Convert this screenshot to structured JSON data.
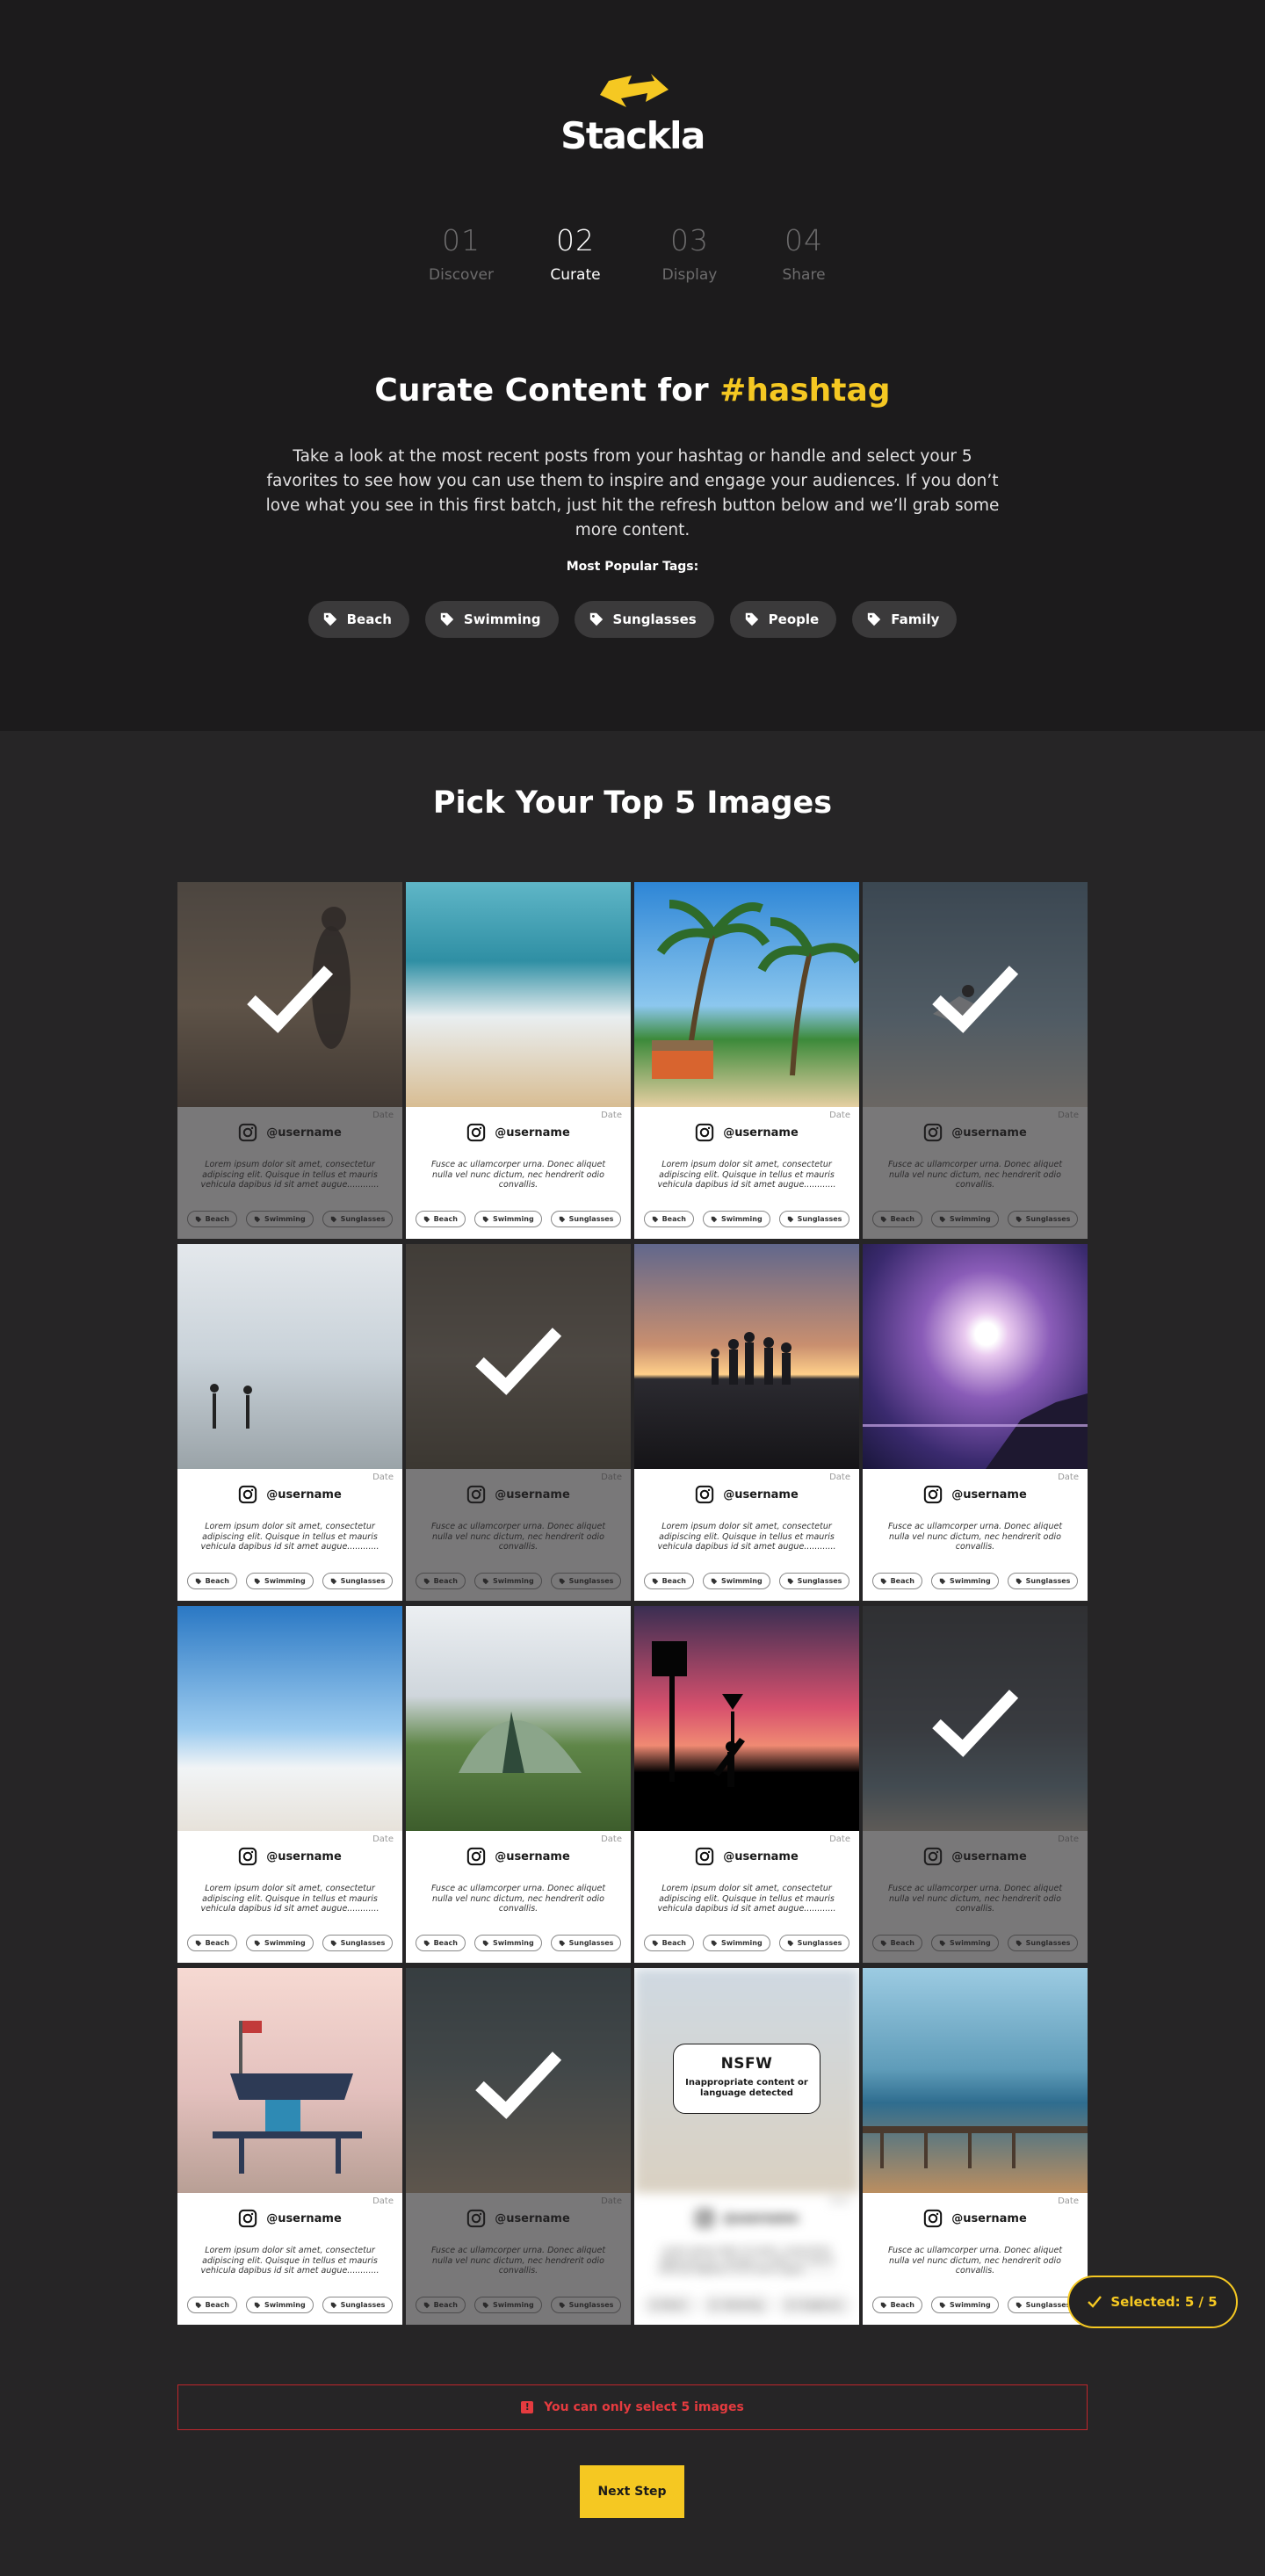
{
  "brand": {
    "name": "Stackla",
    "accent": "#f5c822"
  },
  "steps": [
    {
      "num": "01",
      "label": "Discover"
    },
    {
      "num": "02",
      "label": "Curate"
    },
    {
      "num": "03",
      "label": "Display"
    },
    {
      "num": "04",
      "label": "Share"
    }
  ],
  "curate": {
    "title": "Curate Content for",
    "hashtag": "#hashtag",
    "intro": "Take a look at the most recent posts from your hashtag or handle and select your 5 favorites to see how you can use them to inspire and engage your audiences. If you don’t love what you see in this first batch, just hit the refresh button below and we’ll grab some more content.",
    "popular_label": "Most Popular Tags:",
    "popular_tags": [
      "Beach",
      "Swimming",
      "Sunglasses",
      "People",
      "Family"
    ]
  },
  "pick": {
    "title": "Pick Your Top 5 Images",
    "date_label": "Date",
    "username": "@username",
    "caption_a": "Lorem ipsum dolor sit amet, consectetur adipiscing elit. Quisque in tellus et mauris vehicula dapibus id sit amet augue............",
    "caption_b": "Fusce ac ullamcorper urna. Donec aliquet nulla vel nunc dictum, nec hendrerit odio convallis.",
    "card_tags": [
      "Beach",
      "Swimming",
      "Sunglasses"
    ],
    "nsfw_title": "NSFW",
    "nsfw_text": "Inappropriate content or language detected"
  },
  "selected_label": "Selected: 5 / 5",
  "warning": "You can only select 5 images",
  "next_button": "Next Step"
}
